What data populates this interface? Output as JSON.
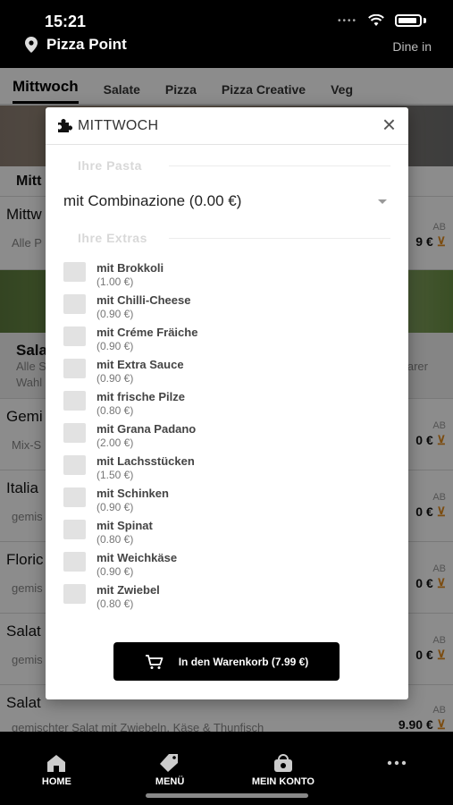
{
  "status_bar": {
    "time": "15:21"
  },
  "header": {
    "restaurant": "Pizza Point",
    "mode": "Dine in"
  },
  "categories": [
    "Mittwoch",
    "Salate",
    "Pizza",
    "Pizza Creative",
    "Veg"
  ],
  "background": {
    "section_title": "Mitt",
    "rows": [
      {
        "title": "Mittw",
        "sub": "Alle P",
        "ab": "AB",
        "price": "9 €"
      },
      {
        "title": "Sala",
        "sub": "Alle S",
        "sub2": "Wahl",
        "extra_right": "arer"
      },
      {
        "title": "Gemi",
        "sub": "Mix-S",
        "ab": "AB",
        "price": "0 €"
      },
      {
        "title": "Italia",
        "sub": "gemis",
        "ab": "AB",
        "price": "0 €"
      },
      {
        "title": "Floric",
        "sub": "gemis",
        "ab": "AB",
        "price": "0 €"
      },
      {
        "title": "Salat",
        "sub": "gemis",
        "ab": "AB",
        "price": "0 €"
      },
      {
        "title": "Salat",
        "sub": "gemischter Salat mit Zwiebeln, Käse & Thunfisch",
        "ab": "AB",
        "price": "9.90 €"
      }
    ]
  },
  "modal": {
    "title": "MITTWOCH",
    "close_label": "×",
    "pasta_legend": "Ihre Pasta",
    "pasta_selected": "mit Combinazione (0.00 €)",
    "extras_legend": "Ihre Extras",
    "extras": [
      {
        "name": "mit Brokkoli",
        "price": "(1.00 €)"
      },
      {
        "name": "mit Chilli-Cheese",
        "price": "(0.90 €)"
      },
      {
        "name": "mit Créme Fräiche",
        "price": "(0.90 €)"
      },
      {
        "name": "mit Extra Sauce",
        "price": "(0.90 €)"
      },
      {
        "name": "mit frische Pilze",
        "price": "(0.80 €)"
      },
      {
        "name": "mit Grana Padano",
        "price": "(2.00 €)"
      },
      {
        "name": "mit Lachsstücken",
        "price": "(1.50 €)"
      },
      {
        "name": "mit Schinken",
        "price": "(0.90 €)"
      },
      {
        "name": "mit Spinat",
        "price": "(0.80 €)"
      },
      {
        "name": "mit Weichkäse",
        "price": "(0.90 €)"
      },
      {
        "name": "mit Zwiebel",
        "price": "(0.80 €)"
      }
    ],
    "cart_button": "In den Warenkorb (7.99 €)"
  },
  "bottom_nav": [
    {
      "label": "HOME",
      "icon": "home-icon"
    },
    {
      "label": "MENÜ",
      "icon": "tag-icon"
    },
    {
      "label": "MEIN KONTO",
      "icon": "bag-icon"
    },
    {
      "label": "",
      "icon": "more-icon"
    }
  ],
  "colors": {
    "accent": "#e08a1e",
    "bar": "#000000"
  }
}
